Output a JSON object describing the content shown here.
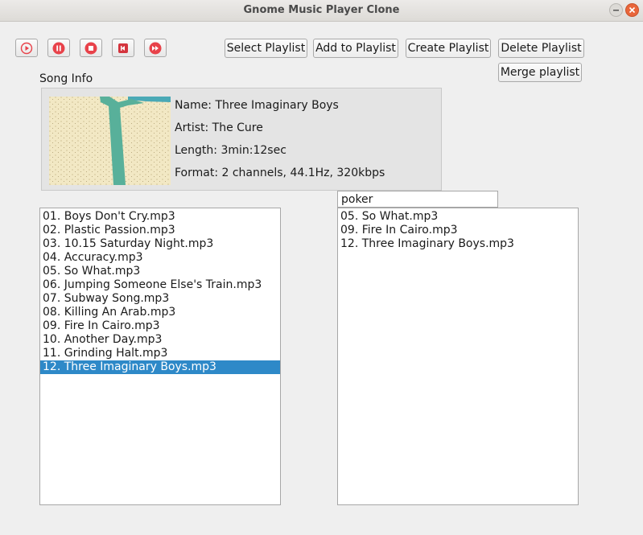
{
  "window": {
    "title": "Gnome Music Player Clone"
  },
  "toolbar": {
    "buttons": [
      {
        "name": "play",
        "icon": "play-icon"
      },
      {
        "name": "pause",
        "icon": "pause-icon"
      },
      {
        "name": "stop",
        "icon": "stop-icon"
      },
      {
        "name": "previous",
        "icon": "previous-icon"
      },
      {
        "name": "next",
        "icon": "fast-forward-icon"
      }
    ]
  },
  "playlist_buttons": {
    "select": "Select Playlist",
    "add": "Add to Playlist",
    "create": "Create Playlist",
    "delete": "Delete Playlist",
    "merge": "Merge playlist"
  },
  "song_info": {
    "heading": "Song Info",
    "name": "Name: Three Imaginary Boys",
    "artist": "Artist: The Cure",
    "length": "Length: 3min:12sec",
    "format": "Format: 2 channels, 44.1Hz, 320kbps"
  },
  "library": {
    "selected_index": 11,
    "items": [
      "01. Boys Don't Cry.mp3",
      "02. Plastic Passion.mp3",
      "03. 10.15 Saturday Night.mp3",
      "04. Accuracy.mp3",
      "05. So What.mp3",
      "06. Jumping Someone Else's Train.mp3",
      "07. Subway Song.mp3",
      "08. Killing An Arab.mp3",
      "09. Fire In Cairo.mp3",
      "10. Another Day.mp3",
      "11. Grinding Halt.mp3",
      "12. Three Imaginary Boys.mp3"
    ]
  },
  "playlist": {
    "name_value": "poker",
    "items": [
      "05. So What.mp3",
      "09. Fire In Cairo.mp3",
      "12. Three Imaginary Boys.mp3"
    ]
  },
  "colors": {
    "accent": "#e8424a",
    "selection": "#2e89c8",
    "close_button": "#e9663a"
  }
}
